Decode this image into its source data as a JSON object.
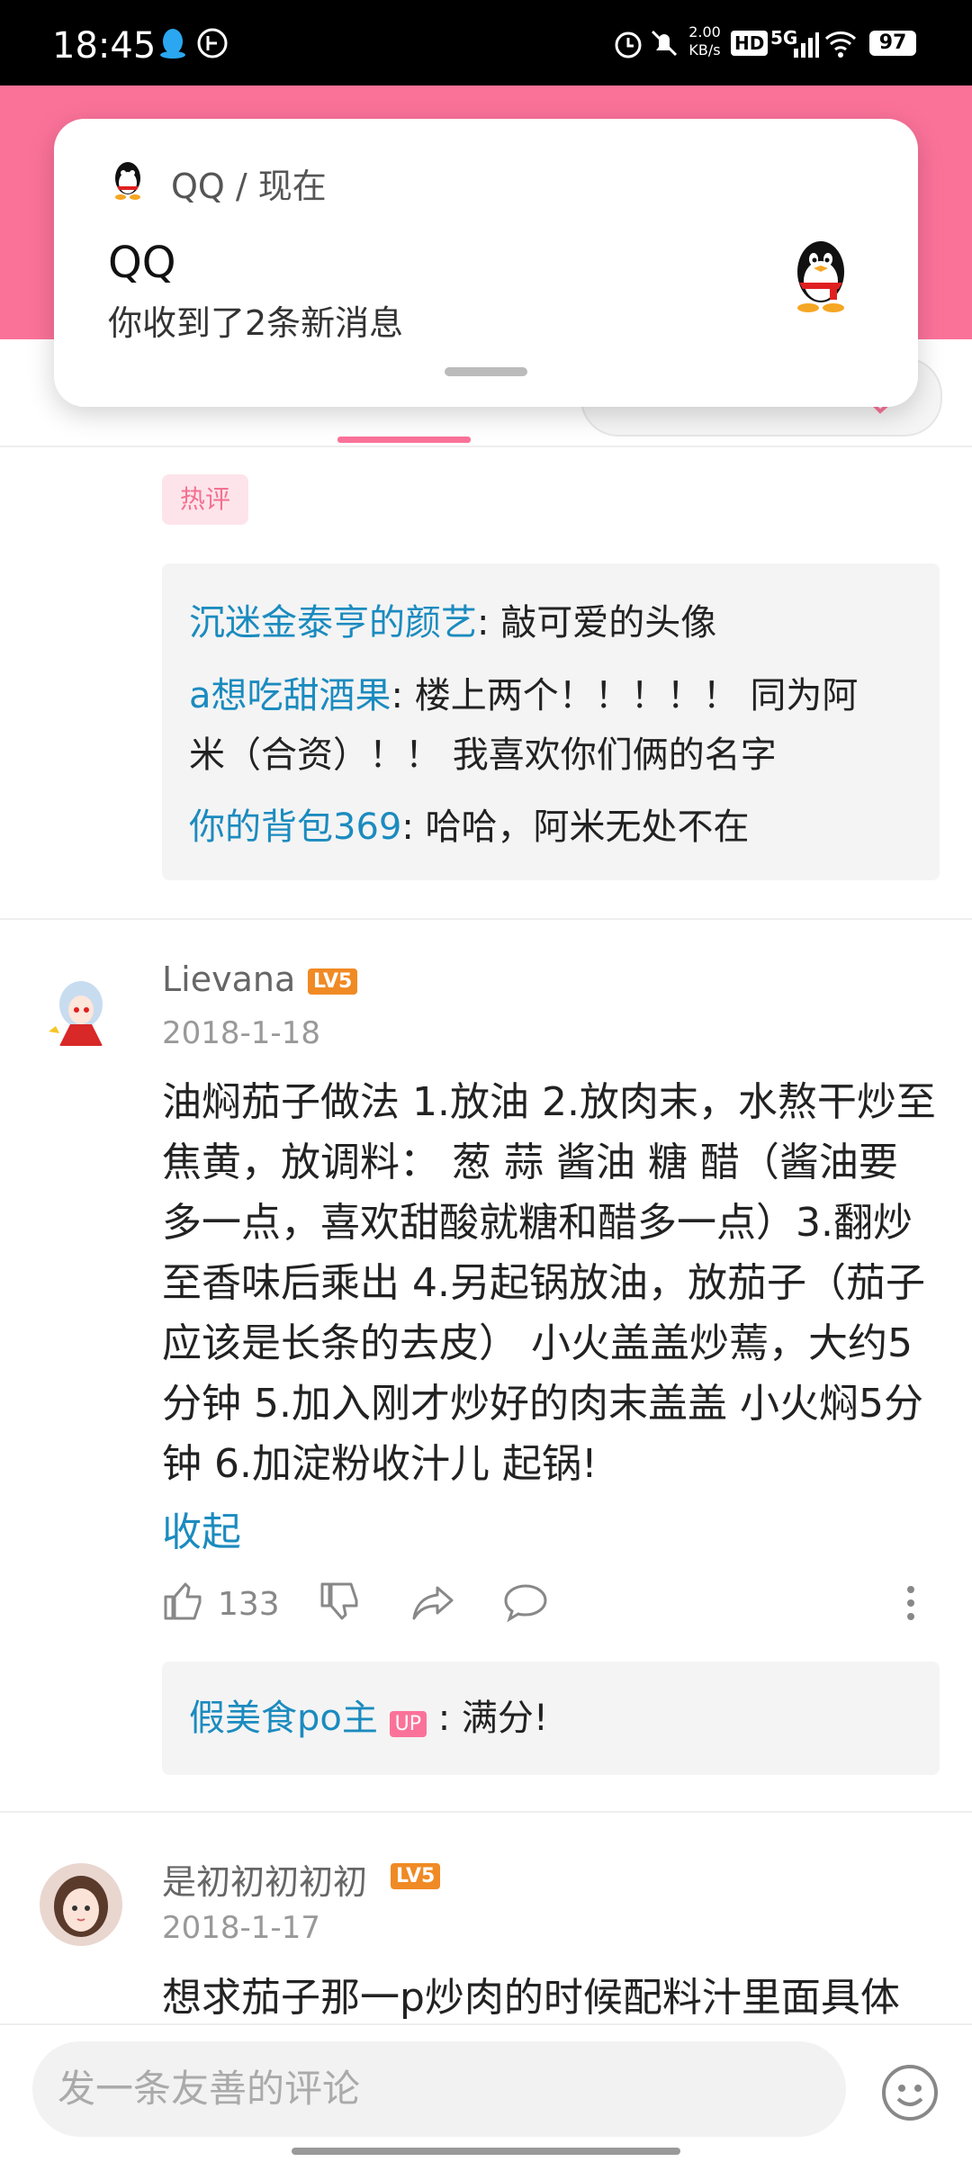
{
  "status": {
    "time": "18:45",
    "net_speed_top": "2.00",
    "net_speed_unit": "KB/s",
    "hd": "HD",
    "signal": "5G",
    "battery": "97"
  },
  "notification": {
    "app_line": "QQ / 现在",
    "title": "QQ",
    "body": "你收到了2条新消息"
  },
  "hot_tag": "热评",
  "replies_1": [
    {
      "user": "沉迷金泰亨的颜艺",
      "text": ": 敲可爱的头像"
    },
    {
      "user": "a想吃甜酒果",
      "text": ": 楼上两个！！！！！ 同为阿"
    },
    {
      "user": "",
      "text": "米（合资）！！ 我喜欢你们俩的名字"
    },
    {
      "user": "你的背包369",
      "text": ": 哈哈，阿米无处不在"
    }
  ],
  "comment_2": {
    "nick": "Lievana",
    "level": "LV5",
    "date": "2018-1-18",
    "lines": [
      "油焖茄子做法 1.放油 2.放肉末，水熬干炒至",
      "焦黄，放调料： 葱 蒜 酱油 糖 醋（酱油要",
      "多一点，喜欢甜酸就糖和醋多一点）3.翻炒",
      "至香味后乘出 4.另起锅放油，放茄子（茄子",
      "应该是长条的去皮） 小火盖盖炒蔫，大约5",
      "分钟 5.加入刚才炒好的肉末盖盖 小火焖5分",
      "钟 6.加淀粉收汁儿 起锅!"
    ],
    "collapse": "收起",
    "likes": "133",
    "reply_user": "假美食po主",
    "reply_badge": "UP",
    "reply_text": ": 满分!"
  },
  "comment_3": {
    "nick": "是初初初初初",
    "level": "LV5",
    "date": "2018-1-17",
    "first_line": "想求茄子那一p炒肉的时候配料汁里面具体"
  },
  "input_placeholder": "发一条友善的评论",
  "colors": {
    "accent": "#fb7299",
    "link": "#1b8bbf",
    "level": "#f08a25"
  }
}
